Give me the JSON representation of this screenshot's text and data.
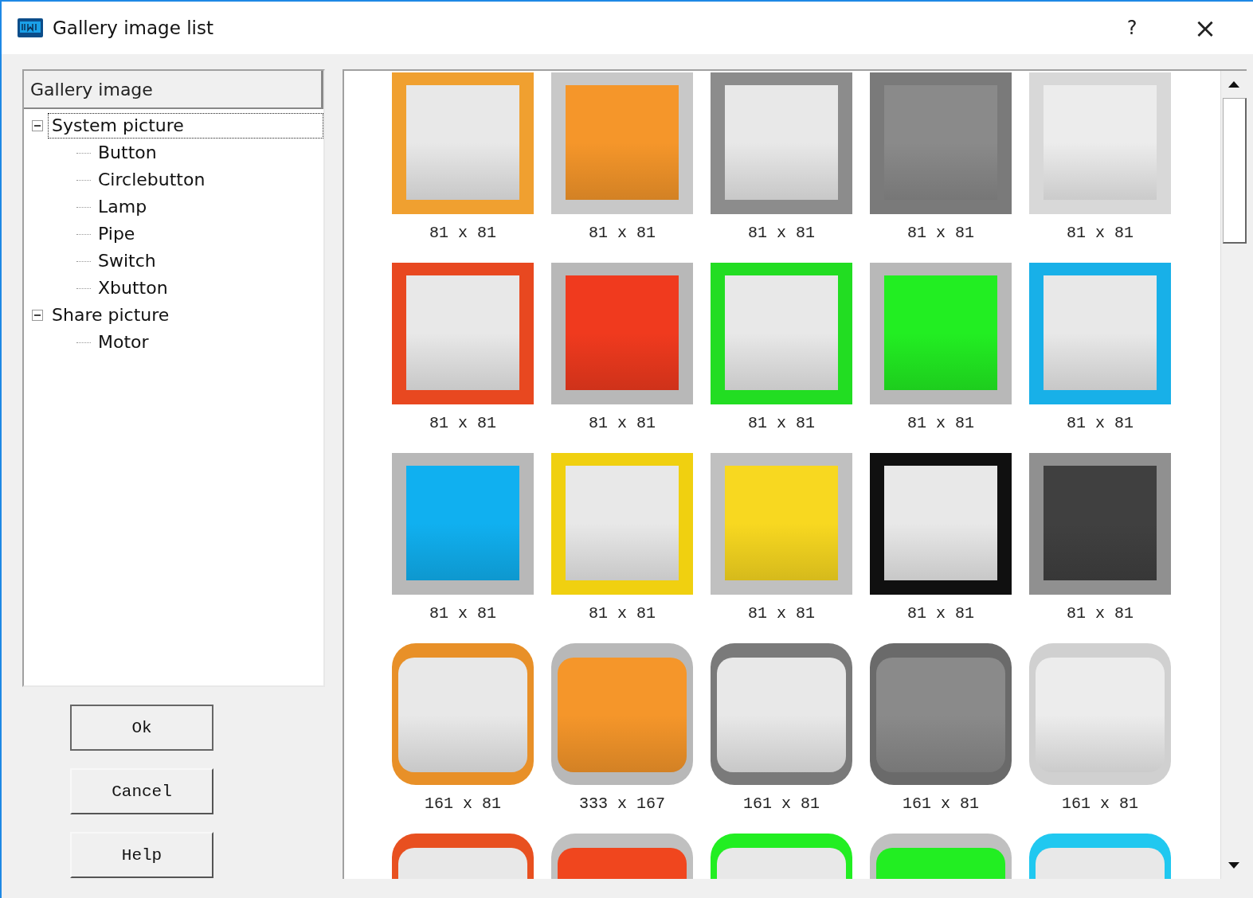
{
  "window": {
    "title": "Gallery image list",
    "help": "?",
    "close": "×"
  },
  "tree": {
    "header": "Gallery image",
    "items": [
      {
        "label": "System picture",
        "expanded": true,
        "selected": true,
        "children": [
          {
            "label": "Button",
            "selected": false
          },
          {
            "label": "Circlebutton",
            "selected": false
          },
          {
            "label": "Lamp",
            "selected": false
          },
          {
            "label": "Pipe",
            "selected": false
          },
          {
            "label": "Switch",
            "selected": false
          },
          {
            "label": "Xbutton",
            "selected": false
          }
        ]
      },
      {
        "label": "Share picture",
        "expanded": true,
        "selected": false,
        "children": [
          {
            "label": "Motor",
            "selected": false
          }
        ]
      }
    ]
  },
  "buttons": [
    "Ok",
    "Cancel",
    "Help"
  ],
  "gallery": [
    {
      "kind": "square",
      "frame": {
        "color": "#f0a030"
      },
      "face": {
        "color": "#e8e8e8"
      },
      "caption": "81 x 81"
    },
    {
      "kind": "square",
      "frame": {
        "color": "#c8c8c8"
      },
      "face": {
        "color": "#f5962a"
      },
      "caption": "81 x 81"
    },
    {
      "kind": "square",
      "frame": {
        "color": "#8c8c8c"
      },
      "face": {
        "color": "#e8e8e8"
      },
      "caption": "81 x 81"
    },
    {
      "kind": "square",
      "frame": {
        "color": "#7a7a7a"
      },
      "face": {
        "color": "#8a8a8a"
      },
      "caption": "81 x 81"
    },
    {
      "kind": "square",
      "frame": {
        "color": "#d8d8d8"
      },
      "face": {
        "color": "#ececec"
      },
      "caption": "81 x 81"
    },
    {
      "kind": "square",
      "frame": {
        "color": "#e84820"
      },
      "face": {
        "color": "#e8e8e8"
      },
      "caption": "81 x 81"
    },
    {
      "kind": "square",
      "frame": {
        "color": "#b8b8b8"
      },
      "face": {
        "color": "#f03a1e"
      },
      "caption": "81 x 81"
    },
    {
      "kind": "square",
      "frame": {
        "color": "#22dd22"
      },
      "face": {
        "color": "#e8e8e8"
      },
      "caption": "81 x 81"
    },
    {
      "kind": "square",
      "frame": {
        "color": "#b8b8b8"
      },
      "face": {
        "color": "#22ee22"
      },
      "caption": "81 x 81"
    },
    {
      "kind": "square",
      "frame": {
        "color": "#18b0e8"
      },
      "face": {
        "color": "#e8e8e8"
      },
      "caption": "81 x 81"
    },
    {
      "kind": "square",
      "frame": {
        "color": "#b8b8b8"
      },
      "face": {
        "color": "#10b0f0"
      },
      "caption": "81 x 81"
    },
    {
      "kind": "square",
      "frame": {
        "color": "#f0d010"
      },
      "face": {
        "color": "#e8e8e8"
      },
      "caption": "81 x 81"
    },
    {
      "kind": "square",
      "frame": {
        "color": "#c0c0c0"
      },
      "face": {
        "color": "#f8d820"
      },
      "caption": "81 x 81"
    },
    {
      "kind": "square",
      "frame": {
        "color": "#101010"
      },
      "face": {
        "color": "#e8e8e8"
      },
      "caption": "81 x 81"
    },
    {
      "kind": "square",
      "frame": {
        "color": "#909090"
      },
      "face": {
        "color": "#404040"
      },
      "caption": "81 x 81"
    },
    {
      "kind": "rounded",
      "frame": {
        "color": "#e89028"
      },
      "face": {
        "color": "#e8e8e8"
      },
      "caption": "161 x 81"
    },
    {
      "kind": "rounded",
      "frame": {
        "color": "#b8b8b8"
      },
      "face": {
        "color": "#f5962a"
      },
      "caption": "333 x 167"
    },
    {
      "kind": "rounded",
      "frame": {
        "color": "#7a7a7a"
      },
      "face": {
        "color": "#e8e8e8"
      },
      "caption": "161 x 81"
    },
    {
      "kind": "rounded",
      "frame": {
        "color": "#6a6a6a"
      },
      "face": {
        "color": "#8a8a8a"
      },
      "caption": "161 x 81"
    },
    {
      "kind": "rounded",
      "frame": {
        "color": "#d0d0d0"
      },
      "face": {
        "color": "#ececec"
      },
      "caption": "161 x 81"
    },
    {
      "kind": "rounded",
      "frame": {
        "color": "#e85020"
      },
      "face": {
        "color": "#e8e8e8"
      }
    },
    {
      "kind": "rounded",
      "frame": {
        "color": "#c0c0c0"
      },
      "face": {
        "color": "#f0461e"
      }
    },
    {
      "kind": "rounded",
      "frame": {
        "color": "#22ee22"
      },
      "face": {
        "color": "#e8e8e8"
      }
    },
    {
      "kind": "rounded",
      "frame": {
        "color": "#c0c0c0"
      },
      "face": {
        "color": "#22ee22"
      }
    },
    {
      "kind": "rounded",
      "frame": {
        "color": "#20c8f0"
      },
      "face": {
        "color": "#e8e8e8"
      }
    }
  ]
}
